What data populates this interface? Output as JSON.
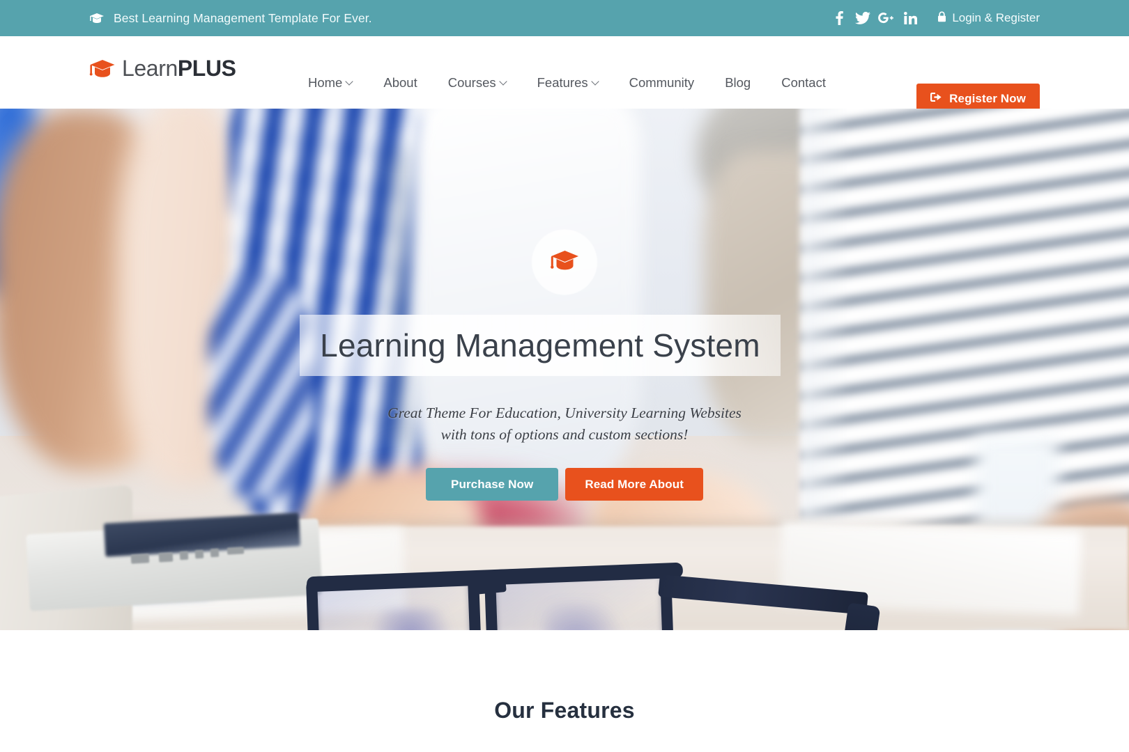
{
  "topbar": {
    "icon": "graduation-cap-icon",
    "tagline": "Best Learning Management Template For Ever.",
    "social": [
      {
        "name": "facebook-icon",
        "glyph": "f"
      },
      {
        "name": "twitter-icon",
        "glyph": "t"
      },
      {
        "name": "google-plus-icon",
        "glyph": "g+"
      },
      {
        "name": "linkedin-icon",
        "glyph": "in"
      }
    ],
    "login_icon": "lock-icon",
    "login_label": "Login & Register"
  },
  "header": {
    "logo_icon": "graduation-cap-icon",
    "logo_part1": "Learn",
    "logo_part2": "PLUS",
    "nav": [
      {
        "label": "Home",
        "caret": true
      },
      {
        "label": "About",
        "caret": false
      },
      {
        "label": "Courses",
        "caret": true
      },
      {
        "label": "Features",
        "caret": true
      },
      {
        "label": "Community",
        "caret": false
      },
      {
        "label": "Blog",
        "caret": false
      },
      {
        "label": "Contact",
        "caret": false
      }
    ],
    "register_icon": "sign-in-icon",
    "register_label": "Register Now"
  },
  "hero": {
    "badge_icon": "graduation-cap-icon",
    "title": "Learning Management System",
    "subtitle_line1": "Great Theme For Education, University Learning Websites",
    "subtitle_line2": "with tons of options and custom sections!",
    "primary_button": "Purchase Now",
    "secondary_button": "Read More About"
  },
  "features": {
    "title": "Our Features"
  },
  "colors": {
    "teal": "#56a3ad",
    "orange": "#e8511d",
    "nav_text": "#54585f",
    "heading": "#26303f"
  }
}
